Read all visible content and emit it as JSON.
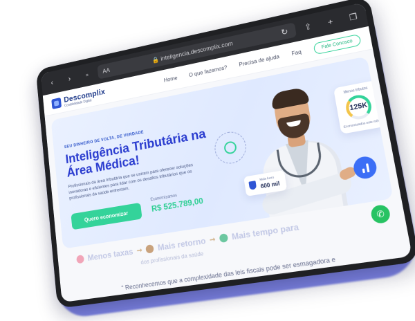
{
  "browser": {
    "reader_label": "AA",
    "url": "inteligencia.descomplix.com",
    "icons": [
      "back-icon",
      "forward-icon",
      "book-icon",
      "lock-icon",
      "reload-icon",
      "share-icon",
      "new-tab-icon",
      "tabs-icon"
    ]
  },
  "site": {
    "logo_text": "Descomplix",
    "logo_sub": "Contabilidade Digital",
    "menu": [
      "Home",
      "O que fazemos?",
      "Precisa de ajuda",
      "Faq"
    ],
    "cta_label": "Fale Conosco"
  },
  "hero": {
    "eyebrow": "SEU DINHEIRO DE VOLTA, DE VERDADE",
    "title": "Inteligência Tributária na Área Médica!",
    "description": "Profissionais da área tributária que se uniram para oferecer soluções inovadoras e eficientes para lidar com os desafios tributários que os profissionais da saúde enfrentam.",
    "button_label": "Quero economizar",
    "saving_label": "Economizamos",
    "saving_value": "R$ 525.789,00"
  },
  "cards": {
    "gauge_label": "Menos tributos",
    "gauge_value": "125K",
    "gauge_caption": "Economizados este mês",
    "revenue_label": "Mais lucro",
    "revenue_value": "600 mil"
  },
  "benefits": {
    "items": [
      "Menos taxas",
      "Mais retorno",
      "Mais tempo para"
    ],
    "sub": "dos profissionais da saúde"
  },
  "footer_text": "\" Reconhecemos que a complexidade das leis fiscais pode ser esmagadora e",
  "colors": {
    "accent": "#34d39a",
    "brand": "#2a3ccf",
    "frame_glow": "#7f86e8"
  }
}
